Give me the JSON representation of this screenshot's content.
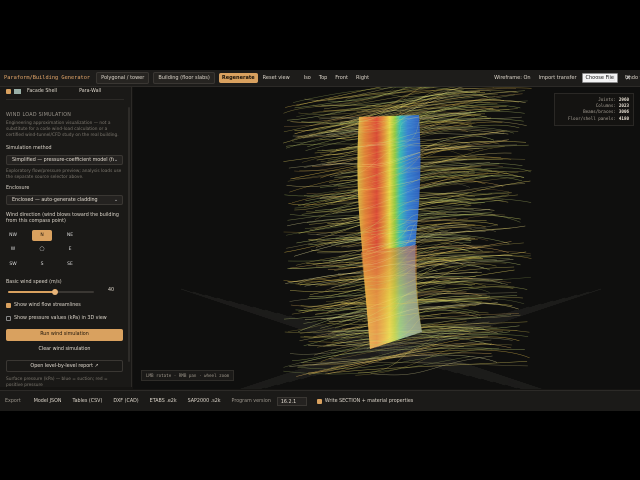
{
  "topbar": {
    "title": "Paraform/Building Generator",
    "shape_select": "Polygonal / tower",
    "mode_select": "Building (floor slabs)",
    "regenerate": "Regenerate",
    "reset_view": "Reset view",
    "views": [
      "Iso",
      "Top",
      "Front",
      "Right"
    ],
    "wireframe": "Wireframe: On",
    "import_transfer": "Import transfer",
    "choose_file": "Choose File",
    "undo": "Undo tran"
  },
  "sidebar": {
    "layer_label": "Facade Shell",
    "layer_type": "Para-Wall",
    "section_title": "WIND LOAD SIMULATION",
    "disclaimer": "Engineering approximation visualization — not a substitute for a code wind-load calculation or a certified wind-tunnel/CFD study on the real building.",
    "method_label": "Simulation method",
    "method_value": "Simplified — pressure-coefficient model (fa",
    "method_note": "Exploratory flow/pressure preview; analysis loads use the separate source selector above.",
    "enclosure_label": "Enclosure",
    "enclosure_value": "Enclosed — auto-generate cladding",
    "direction_label": "Wind direction (wind blows toward the building from this compass point)",
    "compass": [
      "NW",
      "N",
      "NE",
      "W",
      "◯",
      "E",
      "SW",
      "S",
      "SE"
    ],
    "compass_active": "N",
    "speed_label": "Basic wind speed (m/s)",
    "speed_value": "40",
    "speed_fraction": 0.55,
    "show_streamlines": "Show wind flow streamlines",
    "show_pressure": "Show pressure values (kPa) in 3D view",
    "run_button": "Run wind simulation",
    "clear_button": "Clear wind simulation",
    "report_button": "Open level-by-level report ↗",
    "legend_note": "Surface pressure (kPa) — blue = suction; red = positive pressure"
  },
  "viewport": {
    "stats": [
      {
        "label": "Joints:",
        "value": "2960"
      },
      {
        "label": "Columns:",
        "value": "2023"
      },
      {
        "label": "Beams/braces:",
        "value": "3006"
      },
      {
        "label": "Floor/shell panels:",
        "value": "4180"
      }
    ],
    "hint": "LMB rotate · RMB pan · wheel zoom"
  },
  "bottombar": {
    "export_label": "Export",
    "buttons": [
      "Model JSON",
      "Tables (CSV)",
      "DXF (CAD)",
      "ETABS .e2k",
      "SAP2000 .s2k"
    ],
    "program_label": "Program version",
    "program_value": "16.2.1",
    "write_section": "Write SECTION + material properties"
  },
  "colors": {
    "accent": "#d9a15f",
    "panel": "#1a1917",
    "background": "#0f0f0e"
  }
}
